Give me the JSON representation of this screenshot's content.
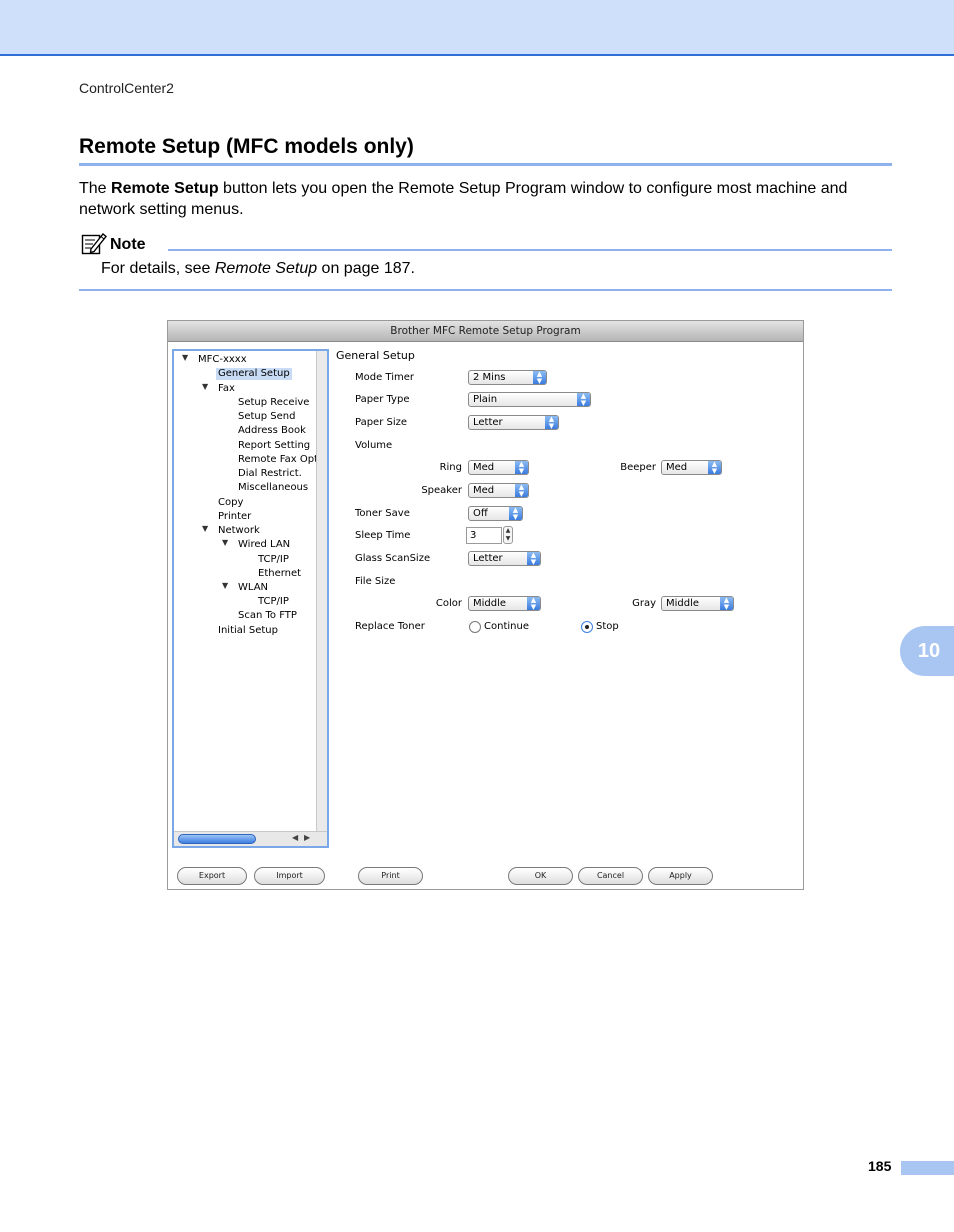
{
  "header": {
    "running_title": "ControlCenter2"
  },
  "section": {
    "title": "Remote Setup (MFC models only)",
    "body_prefix": "The ",
    "body_bold": "Remote Setup",
    "body_suffix": " button lets you open the Remote Setup Program window to configure most machine and network setting menus."
  },
  "note": {
    "label": "Note",
    "text_prefix": "For details, see ",
    "text_italic": "Remote Setup",
    "text_suffix": " on page 187."
  },
  "chapter_tab": "10",
  "page_number": "185",
  "dialog": {
    "title": "Brother MFC Remote Setup Program",
    "tree": {
      "root": "MFC-xxxx",
      "general_setup": "General Setup",
      "fax": "Fax",
      "setup_receive": "Setup Receive",
      "setup_send": "Setup Send",
      "address_book": "Address Book",
      "report_setting": "Report Setting",
      "remote_fax_opt": "Remote Fax Opt",
      "dial_restrict": "Dial Restrict.",
      "miscellaneous": "Miscellaneous",
      "copy": "Copy",
      "printer": "Printer",
      "network": "Network",
      "wired_lan": "Wired LAN",
      "wired_tcpip": "TCP/IP",
      "ethernet": "Ethernet",
      "wlan": "WLAN",
      "wlan_tcpip": "TCP/IP",
      "scan_to_ftp": "Scan To FTP",
      "initial_setup": "Initial Setup"
    },
    "panel": {
      "heading": "General Setup",
      "mode_timer_label": "Mode Timer",
      "mode_timer_value": "2 Mins",
      "paper_type_label": "Paper Type",
      "paper_type_value": "Plain",
      "paper_size_label": "Paper Size",
      "paper_size_value": "Letter",
      "volume_label": "Volume",
      "ring_label": "Ring",
      "ring_value": "Med",
      "beeper_label": "Beeper",
      "beeper_value": "Med",
      "speaker_label": "Speaker",
      "speaker_value": "Med",
      "toner_save_label": "Toner Save",
      "toner_save_value": "Off",
      "sleep_time_label": "Sleep Time",
      "sleep_time_value": "3",
      "glass_scansize_label": "Glass ScanSize",
      "glass_scansize_value": "Letter",
      "file_size_label": "File Size",
      "color_label": "Color",
      "color_value": "Middle",
      "gray_label": "Gray",
      "gray_value": "Middle",
      "replace_toner_label": "Replace Toner",
      "continue_label": "Continue",
      "stop_label": "Stop"
    },
    "buttons": {
      "export": "Export",
      "import": "Import",
      "print": "Print",
      "ok": "OK",
      "cancel": "Cancel",
      "apply": "Apply"
    }
  }
}
